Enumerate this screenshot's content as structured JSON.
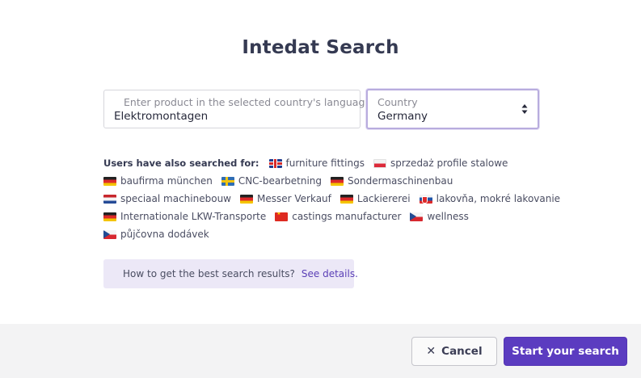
{
  "dialog": {
    "title": "Intedat Search"
  },
  "product_field": {
    "label": "Enter product in the selected country's language",
    "value": "Elektromontagen"
  },
  "country_field": {
    "label": "Country",
    "value": "Germany"
  },
  "also_searched": {
    "label": "Users have also searched for:",
    "rows": [
      [
        {
          "flag": "gb",
          "text": "furniture fittings"
        },
        {
          "flag": "pl",
          "text": "sprzedaż profile stalowe"
        }
      ],
      [
        {
          "flag": "de",
          "text": "baufirma münchen"
        },
        {
          "flag": "se",
          "text": "CNC-bearbetning"
        },
        {
          "flag": "de",
          "text": "Sondermaschinenbau"
        }
      ],
      [
        {
          "flag": "nl",
          "text": "speciaal machinebouw"
        },
        {
          "flag": "de",
          "text": "Messer Verkauf"
        },
        {
          "flag": "de",
          "text": "Lackiererei"
        },
        {
          "flag": "sk",
          "text": "lakovňa, mokré lakovanie"
        }
      ],
      [
        {
          "flag": "de",
          "text": "Internationale LKW-Transporte"
        },
        {
          "flag": "cn",
          "text": "castings manufacturer"
        },
        {
          "flag": "cz",
          "text": "wellness"
        }
      ],
      [
        {
          "flag": "cz",
          "text": "půjčovna dodávek"
        }
      ]
    ]
  },
  "tip": {
    "icon": "lightbulb-icon",
    "text": "How to get the best search results?",
    "link": "See details."
  },
  "footer": {
    "cancel_label": "Cancel",
    "start_label": "Start your search"
  },
  "colors": {
    "accent": "#5b3cc0",
    "tip_bg": "#ece8f7",
    "footer_bg": "#f3f3f4",
    "title": "#353a52"
  }
}
